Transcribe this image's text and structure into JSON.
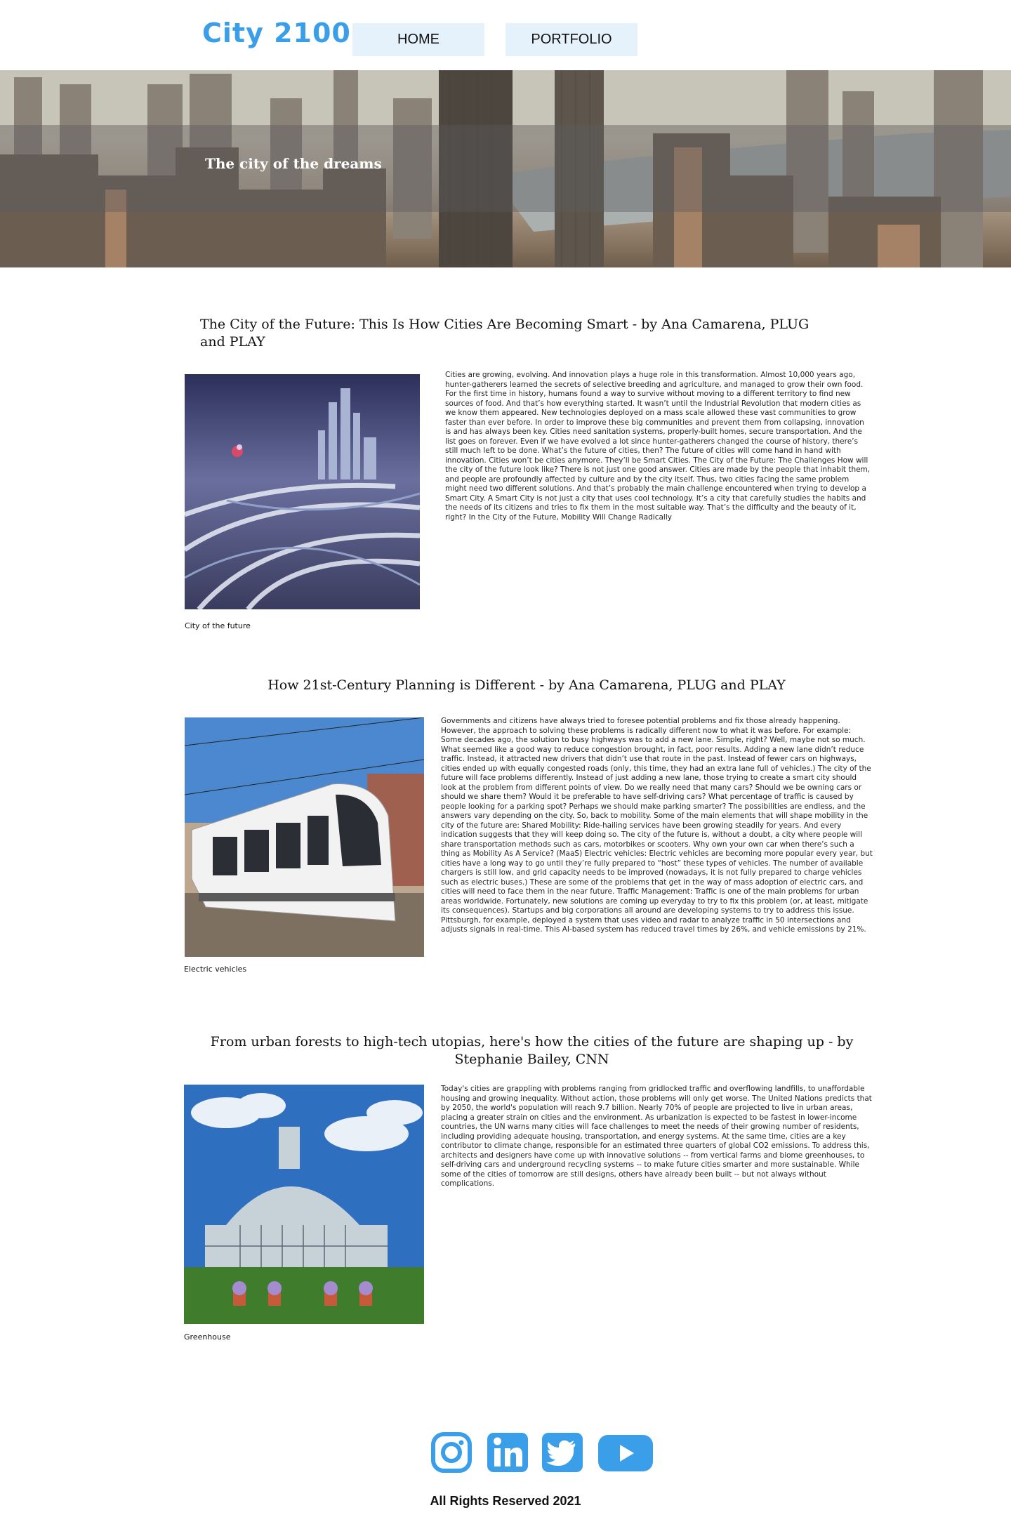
{
  "header": {
    "logo": "City 2100",
    "nav": {
      "home": "HOME",
      "portfolio": "PORTFOLIO"
    }
  },
  "hero": {
    "title": "The city of the dreams"
  },
  "articles": [
    {
      "title": "The City of the Future: This Is How Cities Are Becoming Smart - by Ana Camarena, PLUG and PLAY",
      "caption": "City of the future",
      "body": "Cities are growing, evolving. And innovation plays a huge role in this transformation. Almost 10,000 years ago, hunter-gatherers learned the secrets of selective breeding and agriculture, and managed to grow their own food. For the first time in history, humans found a way to survive without moving to a different territory to find new sources of food. And that’s how everything started. It wasn’t until the Industrial Revolution that modern cities as we know them appeared. New technologies deployed on a mass scale allowed these vast communities to grow faster than ever before. In order to improve these big communities and prevent them from collapsing, innovation is and has always been key. Cities need sanitation systems, properly-built homes, secure transportation. And the list goes on forever. Even if we have evolved a lot since hunter-gatherers changed the course of history, there’s still much left to be done. What’s the future of cities, then? The future of cities will come hand in hand with innovation. Cities won’t be cities anymore. They’ll be Smart Cities. The City of the Future: The Challenges How will the city of the future look like? There is not just one good answer. Cities are made by the people that inhabit them, and people are profoundly affected by culture and by the city itself. Thus, two cities facing the same problem might need two different solutions. And that’s probably the main challenge encountered when trying to develop a Smart City. A Smart City is not just a city that uses cool technology. It’s a city that carefully studies the habits and the needs of its citizens and tries to fix them in the most suitable way. That’s the difficulty and the beauty of it, right? In the City of the Future, Mobility Will Change Radically"
    },
    {
      "title": "How 21st-Century Planning is Different - by Ana Camarena, PLUG and PLAY",
      "caption": "Electric vehicles",
      "body": "Governments and citizens have always tried to foresee potential problems and fix those already happening. However, the approach to solving these problems is radically different now to what it was before. For example: Some decades ago, the solution to busy highways was to add a new lane. Simple, right? Well, maybe not so much. What seemed like a good way to reduce congestion brought, in fact, poor results. Adding a new lane didn’t reduce traffic. Instead, it attracted new drivers that didn’t use that route in the past. Instead of fewer cars on highways, cities ended up with equally congested roads (only, this time, they had an extra lane full of vehicles.) The city of the future will face problems differently. Instead of just adding a new lane, those trying to create a smart city should look at the problem from different points of view. Do we really need that many cars? Should we be owning cars or should we share them? Would it be preferable to have self-driving cars? What percentage of traffic is caused by people looking for a parking spot? Perhaps we should make parking smarter? The possibilities are endless, and the answers vary depending on the city. So, back to mobility. Some of the main elements that will shape mobility in the city of the future are: Shared Mobility: Ride-hailing services have been growing steadily for years. And every indication suggests that they will keep  doing so. The city of the future is, without a doubt, a city where people will share transportation methods such as cars, motorbikes or scooters. Why own your own car when there’s such a thing as Mobility As A Service? (MaaS) Electric vehicles: Electric vehicles are becoming more popular every year, but cities have a long way to go until they’re fully prepared to “host” these types of vehicles. The number of available chargers is still low, and grid capacity needs to be improved (nowadays, it is not fully prepared to charge vehicles such as electric buses.) These are some of the problems that get in the way of mass adoption of electric cars, and cities will need to face them in the near future. Traffic Management: Traffic is one of the main problems for urban areas worldwide. Fortunately, new solutions are coming up everyday to try to fix this problem (or, at least, mitigate its consequences). Startups and big corporations all around are developing systems to try to address this issue. Pittsburgh, for example, deployed a system that uses video and radar to analyze traffic in 50 intersections and adjusts signals in real-time. This AI-based system has reduced travel times by 26%, and vehicle emissions by 21%."
    },
    {
      "title": "From urban forests to high-tech utopias, here's how the cities of the future are shaping up - by Stephanie Bailey, CNN",
      "caption": "Greenhouse",
      "body": "Today's cities are grappling with problems ranging from gridlocked traffic and overflowing landfills, to unaffordable housing and growing inequality. Without action, those problems will only get worse. The United Nations predicts that by 2050, the world's population will reach 9.7 billion. Nearly 70% of people are projected to live in urban areas, placing a greater strain on cities and the environment. As urbanization is expected to be fastest in lower-income countries, the UN warns many cities will face challenges to meet the needs of their growing number of residents, including providing adequate housing, transportation, and energy systems. At the same time, cities are a key contributor to climate change, responsible for an estimated three quarters of global CO2 emissions. To address this, architects and designers have come up with innovative solutions -- from vertical farms and biome greenhouses, to self-driving cars and underground recycling systems -- to make future cities smarter and more sustainable. While some of the cities of tomorrow are still designs, others have already been built -- but not always without complications."
    }
  ],
  "footer": {
    "social_icons": [
      "instagram-icon",
      "linkedin-icon",
      "twitter-icon",
      "youtube-icon"
    ],
    "copyright": "All Rights Reserved 2021",
    "icon_color": "#3a9fe8"
  }
}
